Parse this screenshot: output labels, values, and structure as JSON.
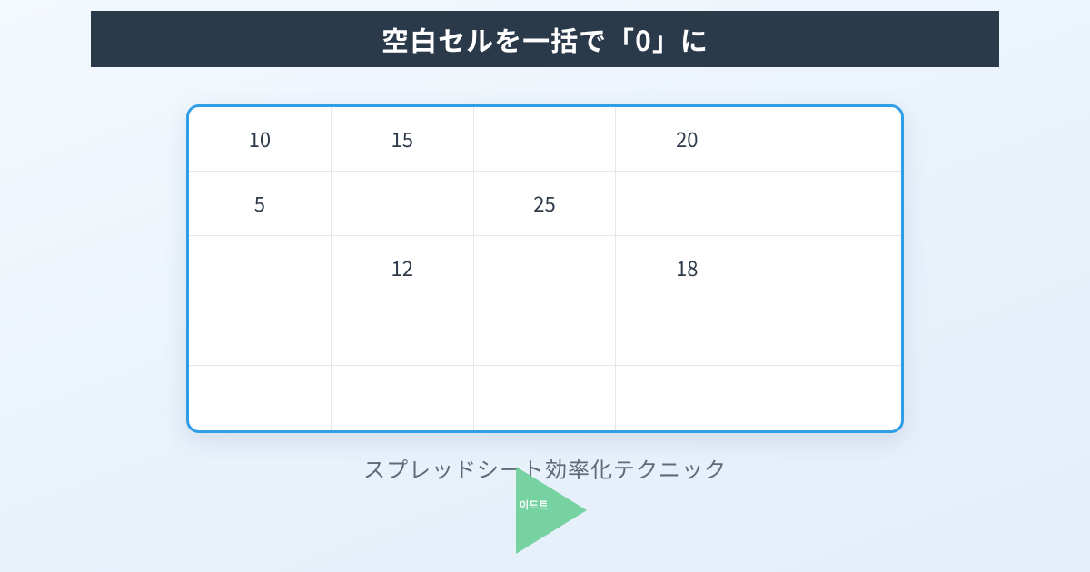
{
  "title": "空白セルを一括で「0」に",
  "subtitle": "スプレッドシート効率化テクニック",
  "play_badge": "이드트",
  "grid": {
    "rows": 5,
    "cols": 5,
    "cells": [
      [
        "10",
        "15",
        "",
        "20",
        ""
      ],
      [
        "5",
        "",
        "25",
        "",
        ""
      ],
      [
        "",
        "12",
        "",
        "18",
        ""
      ],
      [
        "",
        "",
        "",
        "",
        ""
      ],
      [
        "",
        "",
        "",
        "",
        ""
      ]
    ]
  },
  "colors": {
    "title_bg": "#2b3a4b",
    "title_fg": "#ffffff",
    "sheet_border": "#2f9ee6",
    "cell_border": "#e4e8ec",
    "text": "#2e3b4a",
    "subtitle": "#5f6b78",
    "play": "#6ecf9a"
  }
}
